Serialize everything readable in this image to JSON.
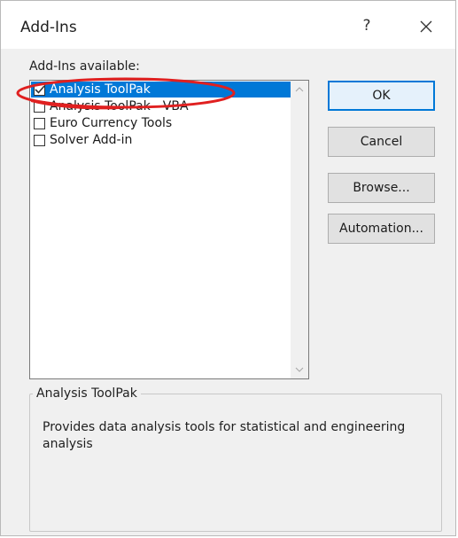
{
  "dialog": {
    "title": "Add-Ins",
    "help_glyph": "?",
    "close_icon": "close-icon"
  },
  "list": {
    "label": "Add-Ins available:",
    "items": [
      {
        "label": "Analysis ToolPak",
        "checked": true,
        "selected": true
      },
      {
        "label": "Analysis ToolPak - VBA",
        "checked": false,
        "selected": false
      },
      {
        "label": "Euro Currency Tools",
        "checked": false,
        "selected": false
      },
      {
        "label": "Solver Add-in",
        "checked": false,
        "selected": false
      }
    ]
  },
  "buttons": {
    "ok": "OK",
    "cancel": "Cancel",
    "browse": "Browse...",
    "automation": "Automation..."
  },
  "details": {
    "title": "Analysis ToolPak",
    "description": "Provides data analysis tools for statistical and engineering analysis"
  },
  "colors": {
    "selection": "#0078d7",
    "annotation": "#e02020"
  }
}
